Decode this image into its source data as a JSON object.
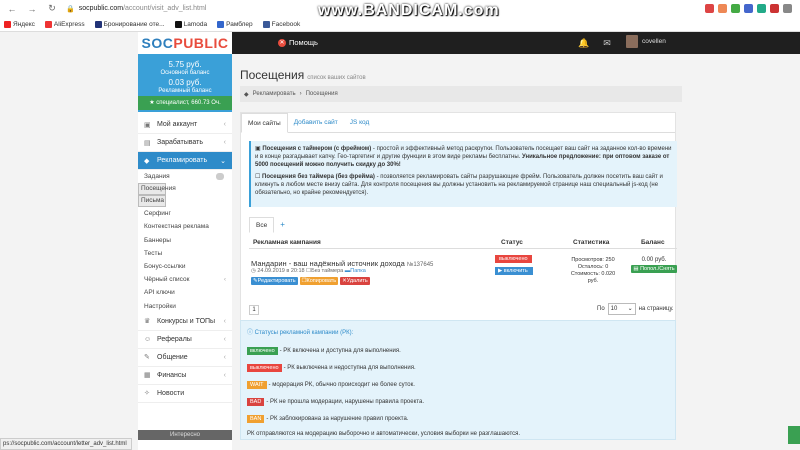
{
  "browser": {
    "url_host": "socpublic.com",
    "url_path": "/account/visit_adv_list.html",
    "recorder": "www.BANDICAM.com",
    "bookmarks": [
      "Яндекс",
      "AliExpress",
      "Бронирование оте...",
      "Lamoda",
      "Рамблер",
      "Facebook"
    ]
  },
  "header": {
    "logo_a": "SOC",
    "logo_b": "PUBLIC",
    "help": "Помощь",
    "username": "covellen"
  },
  "balance": {
    "main_value": "5.75 руб.",
    "main_label": "Основной баланс",
    "ad_value": "0.03 руб.",
    "ad_label": "Рекламный баланс",
    "specialist": "специалист, 660.73 Оч."
  },
  "sidebar": {
    "items_top": [
      {
        "label": "Мой аккаунт",
        "icon": "user-icon"
      },
      {
        "label": "Зарабатывать",
        "icon": "money-icon"
      }
    ],
    "active": {
      "label": "Рекламировать",
      "icon": "bullhorn-icon"
    },
    "subitems": [
      "Задания",
      "Посещения",
      "Письма",
      "Серфинг",
      "Контекстная реклама",
      "Баннеры",
      "Тесты",
      "Бонус-ссылки",
      "Чёрный список",
      "API ключи",
      "Настройки"
    ],
    "items_bottom": [
      {
        "label": "Конкурсы и ТОПы",
        "icon": "trophy-icon"
      },
      {
        "label": "Рефералы",
        "icon": "users-icon"
      },
      {
        "label": "Общение",
        "icon": "chat-icon"
      },
      {
        "label": "Финансы",
        "icon": "wallet-icon"
      },
      {
        "label": "Новости",
        "icon": "news-icon"
      }
    ],
    "interest": "Интересно"
  },
  "main": {
    "title": "Посещения",
    "subtitle": "список ваших сайтов",
    "breadcrumb": [
      "Рекламировать",
      "Посещения"
    ],
    "tabs": [
      "Мои сайты",
      "Добавить сайт",
      "JS код"
    ],
    "info1_bold": "Посещения с таймером (с фреймом)",
    "info1_text": " - простой и эффективный метод раскрутки. Пользователь посещает ваш сайт на заданное кол-во времени и в конце разгадывает капчу. Гео-таргетинг и другие функции в этом виде рекламы бесплатны. ",
    "info1_offer": "Уникальное предложение: при оптовом заказе от 5000 посещений можно получить скидку до 30%!",
    "info2_bold": "Посещения без таймера (без фрейма)",
    "info2_text": " - позволяется рекламировать сайты разрушающие фрейм. Пользователь должен посетить ваш сайт и кликнуть в любом месте внизу сайта. Для контроля посещения вы должны установить на рекламируемой странице наш специальный js-код (не обязательно, но крайне рекомендуется).",
    "subtab_all": "Все",
    "subtab_add": "+",
    "columns": [
      "Рекламная кампания",
      "Статус",
      "Статистика",
      "Баланс"
    ],
    "row": {
      "name": "Мандарин - ваш надёжный источник дохода",
      "id": "№137645",
      "date": "24.09.2019 в 20:18",
      "timer": "Без таймера",
      "folder": "Папка",
      "edit": "Редактировать",
      "copy": "Копировать",
      "delete": "Удалить",
      "status": "выключено",
      "enable": "включить",
      "views": "Просмотров: 250",
      "left": "Осталось: 0",
      "cost": "Стоимость: 0.020 руб.",
      "balance": "0.00 руб.",
      "topup": "Попол./Снять"
    },
    "page": "1",
    "per_page_label": "По",
    "per_page_value": "10",
    "per_page_suffix": "на страницу.",
    "legend_title": "Статусы рекламной кампании (РК):",
    "legend": [
      {
        "badge": "включено",
        "text": " - РК включена и доступна для выполнения.",
        "color": "#3aa052"
      },
      {
        "badge": "выключено",
        "text": " - РК выключена и недоступна для выполнения.",
        "color": "#e8463f"
      },
      {
        "badge": "WAIT",
        "text": " - модерация РК, обычно происходит не более суток.",
        "color": "#f0a030"
      },
      {
        "badge": "BAD",
        "text": " - РК не прошла модерации, нарушены правила проекта.",
        "color": "#d9433f"
      },
      {
        "badge": "BAN",
        "text": " - РК заблокирована за нарушение правил проекта.",
        "color": "#f0a030"
      }
    ],
    "legend_footer": "РК отправляются на модерацию выборочно и автоматически, условия выборки не разглашаются."
  },
  "statusbar": "ps://socpublic.com/account/letter_adv_list.html"
}
